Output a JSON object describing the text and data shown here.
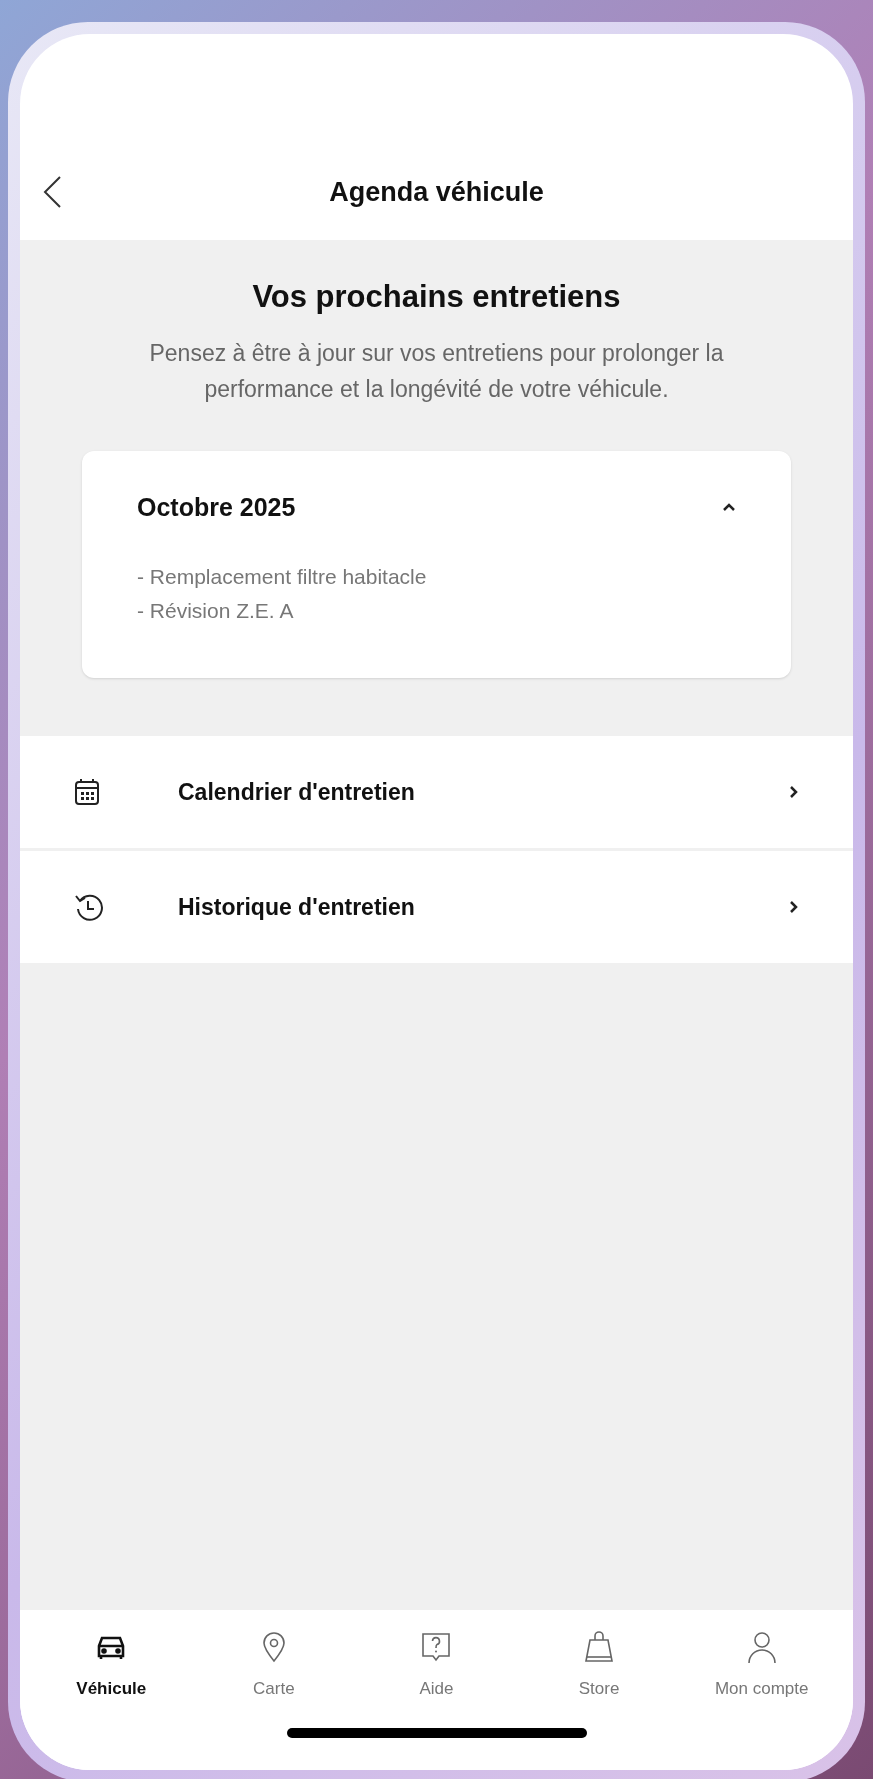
{
  "header": {
    "title": "Agenda véhicule"
  },
  "intro": {
    "heading": "Vos prochains entretiens",
    "text": "Pensez à être à jour sur vos entretiens pour prolonger la performance et la longévité de votre véhicule."
  },
  "upcoming": {
    "month": "Octobre 2025",
    "expanded": true,
    "items": [
      "- Remplacement filtre habitacle",
      "- Révision Z.E. A"
    ]
  },
  "menu": [
    {
      "kind": "calendar",
      "label": "Calendrier d'entretien"
    },
    {
      "kind": "history",
      "label": "Historique d'entretien"
    }
  ],
  "tab_bar": [
    {
      "kind": "car",
      "label": "Véhicule",
      "selected": true
    },
    {
      "kind": "pin",
      "label": "Carte",
      "selected": false
    },
    {
      "kind": "help",
      "label": "Aide",
      "selected": false
    },
    {
      "kind": "bag",
      "label": "Store",
      "selected": false
    },
    {
      "kind": "user",
      "label": "Mon compte",
      "selected": false
    }
  ]
}
